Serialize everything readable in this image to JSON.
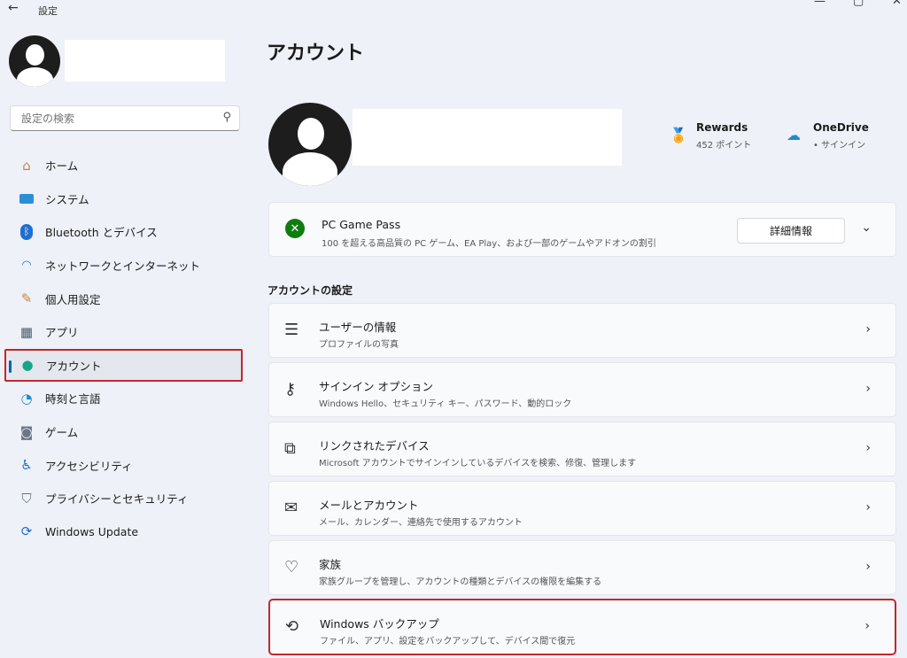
{
  "window": {
    "title": "設定",
    "back_icon": "arrow-left-icon"
  },
  "search": {
    "placeholder": "設定の検索"
  },
  "nav": {
    "items": [
      {
        "label": "ホーム",
        "icon": "home-icon"
      },
      {
        "label": "システム",
        "icon": "monitor-icon"
      },
      {
        "label": "Bluetooth とデバイス",
        "icon": "bluetooth-icon"
      },
      {
        "label": "ネットワークとインターネット",
        "icon": "wifi-icon"
      },
      {
        "label": "個人用設定",
        "icon": "brush-icon"
      },
      {
        "label": "アプリ",
        "icon": "apps-icon"
      },
      {
        "label": "アカウント",
        "icon": "person-icon"
      },
      {
        "label": "時刻と言語",
        "icon": "globe-clock-icon"
      },
      {
        "label": "ゲーム",
        "icon": "gamepad-icon"
      },
      {
        "label": "アクセシビリティ",
        "icon": "accessibility-icon"
      },
      {
        "label": "プライバシーとセキュリティ",
        "icon": "shield-icon"
      },
      {
        "label": "Windows Update",
        "icon": "update-icon"
      }
    ],
    "active_index": 6
  },
  "main": {
    "title": "アカウント",
    "rewards": {
      "title": "Rewards",
      "sub": "452 ポイント"
    },
    "onedrive": {
      "title": "OneDrive",
      "sub": "• サインイン"
    },
    "gamepass": {
      "title": "PC Game Pass",
      "sub": "100 を超える高品質の PC ゲーム、EA Play、および一部のゲームやアドオンの割引",
      "button": "詳細情報"
    },
    "section_title": "アカウントの設定",
    "rows": [
      {
        "title": "ユーザーの情報",
        "sub": "プロファイルの写真",
        "icon": "user-info-icon"
      },
      {
        "title": "サインイン オプション",
        "sub": "Windows Hello、セキュリティ キー、パスワード、動的ロック",
        "icon": "key-icon"
      },
      {
        "title": "リンクされたデバイス",
        "sub": "Microsoft アカウントでサインインしているデバイスを検索、修復、管理します",
        "icon": "linked-devices-icon"
      },
      {
        "title": "メールとアカウント",
        "sub": "メール、カレンダー、連絡先で使用するアカウント",
        "icon": "mail-icon"
      },
      {
        "title": "家族",
        "sub": "家族グループを管理し、アカウントの種類とデバイスの権限を編集する",
        "icon": "family-heart-icon"
      },
      {
        "title": "Windows バックアップ",
        "sub": "ファイル、アプリ、設定をバックアップして、デバイス間で復元",
        "icon": "backup-icon"
      }
    ]
  },
  "colors": {
    "accent": "#005fb8",
    "highlight": "#c0282d",
    "background": "#eef1f7"
  }
}
